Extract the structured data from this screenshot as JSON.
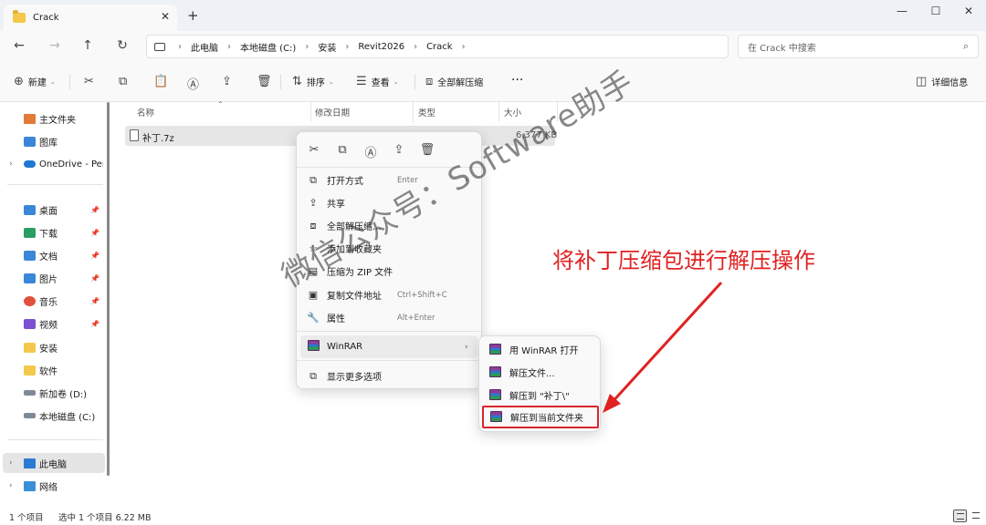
{
  "window": {
    "tab_title": "Crack",
    "new_tab": "+",
    "tab_close": "✕",
    "minimize": "—",
    "maximize": "☐",
    "close": "✕"
  },
  "nav": {
    "back": "←",
    "forward": "→",
    "up": "↑",
    "refresh": "↻",
    "breadcrumbs": [
      "此电脑",
      "本地磁盘 (C:)",
      "安装",
      "Revit2026",
      "Crack"
    ],
    "search_placeholder": "在 Crack 中搜索"
  },
  "toolbar": {
    "new": "新建",
    "sort": "排序",
    "view": "查看",
    "extract_all": "全部解压缩",
    "more": "···",
    "details": "详细信息"
  },
  "sidebar": {
    "items": [
      {
        "label": "主文件夹"
      },
      {
        "label": "图库"
      },
      {
        "label": "OneDrive - Per"
      },
      {
        "label": "桌面"
      },
      {
        "label": "下载"
      },
      {
        "label": "文档"
      },
      {
        "label": "图片"
      },
      {
        "label": "音乐"
      },
      {
        "label": "视频"
      },
      {
        "label": "安装"
      },
      {
        "label": "软件"
      },
      {
        "label": "新加卷 (D:)"
      },
      {
        "label": "本地磁盘 (C:)"
      },
      {
        "label": "此电脑"
      },
      {
        "label": "网络"
      }
    ]
  },
  "columns": {
    "name": "名称",
    "modified": "修改日期",
    "type": "类型",
    "size": "大小"
  },
  "files": [
    {
      "name": "补丁.7z",
      "size": "6,377 KB"
    }
  ],
  "context_menu": {
    "items": [
      {
        "label": "打开方式",
        "shortcut": "Enter",
        "arrow": "›"
      },
      {
        "label": "共享"
      },
      {
        "label": "全部解压缩..."
      },
      {
        "label": "添加到收藏夹"
      },
      {
        "label": "压缩为 ZIP 文件"
      },
      {
        "label": "复制文件地址",
        "shortcut": "Ctrl+Shift+C"
      },
      {
        "label": "属性",
        "shortcut": "Alt+Enter"
      },
      {
        "label": "WinRAR",
        "arrow": "›"
      },
      {
        "label": "显示更多选项"
      }
    ]
  },
  "submenu": {
    "items": [
      {
        "label": "用 WinRAR 打开"
      },
      {
        "label": "解压文件..."
      },
      {
        "label": "解压到 \"补丁\\\""
      },
      {
        "label": "解压到当前文件夹"
      }
    ]
  },
  "overlay": {
    "watermark": "微信公众号：Software助手",
    "annotation": "将补丁压缩包进行解压操作",
    "annotation_color": "#e02222",
    "highlight_color": "#d9262b"
  },
  "status": {
    "item_count": "1 个项目",
    "selection": "选中 1 个项目  6.22 MB"
  }
}
